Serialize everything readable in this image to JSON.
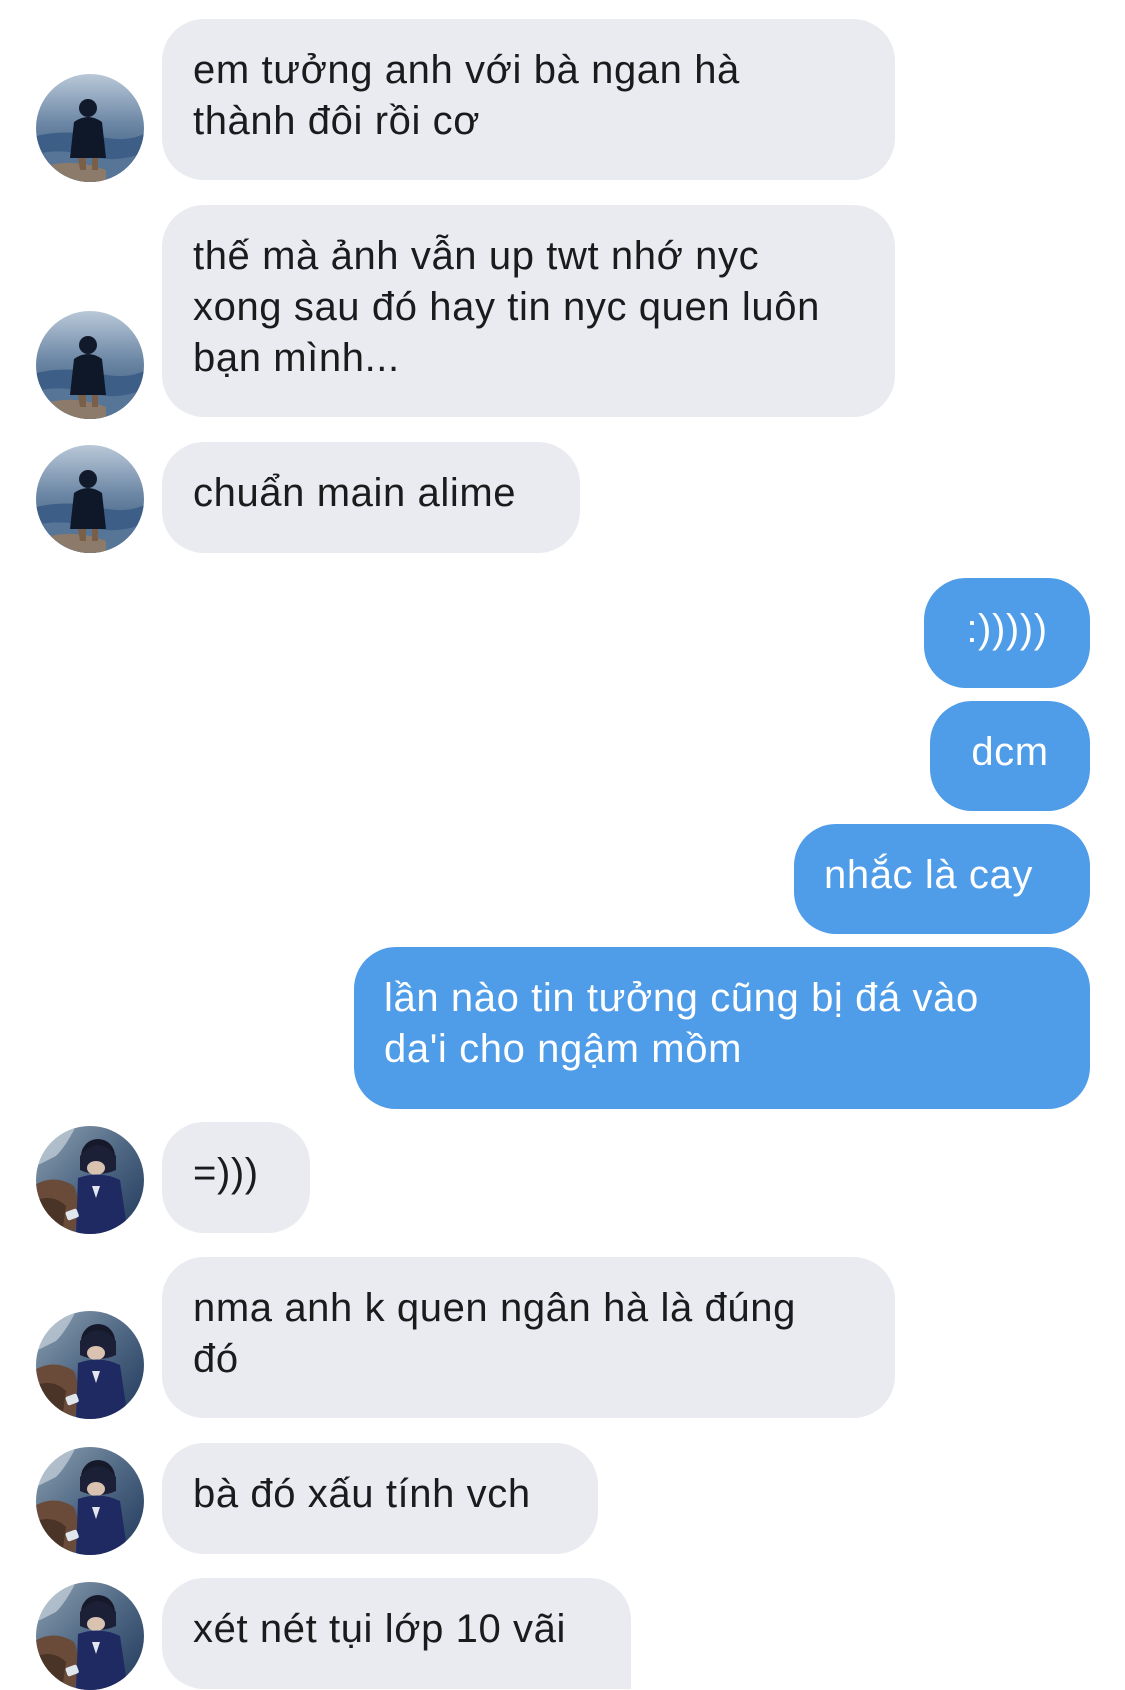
{
  "conversation": {
    "messages": [
      {
        "sender": "them",
        "text": "em tưởng anh với bà ngan hà\nthành đôi rồi cơ"
      },
      {
        "sender": "them",
        "text": "thế mà ảnh vẫn up twt nhớ nyc\nxong sau đó hay tin nyc quen luôn\nbạn mình..."
      },
      {
        "sender": "them",
        "text": "chuẩn main alime"
      },
      {
        "sender": "me",
        "text": ":)))))"
      },
      {
        "sender": "me",
        "text": "dcm"
      },
      {
        "sender": "me",
        "text": "nhắc là cay"
      },
      {
        "sender": "me",
        "text": "lần nào tin tưởng cũng bị đá vào\nda'i cho ngậm mồm"
      },
      {
        "sender": "them",
        "text": "=)))"
      },
      {
        "sender": "them",
        "text": "nma anh k quen ngân hà là đúng\nđó"
      },
      {
        "sender": "them",
        "text": "bà đó xấu tính vch"
      },
      {
        "sender": "them",
        "text": "xét nét tụi lớp 10 vãi"
      }
    ]
  },
  "colors": {
    "received_bubble": "#e9ebf0",
    "sent_bubble": "#4f9ce8",
    "received_text": "#1b1b1d",
    "sent_text": "#ffffff"
  },
  "icons": {
    "avatar_a": "person-at-sea-photo",
    "avatar_b": "person-on-rocks-photo"
  }
}
